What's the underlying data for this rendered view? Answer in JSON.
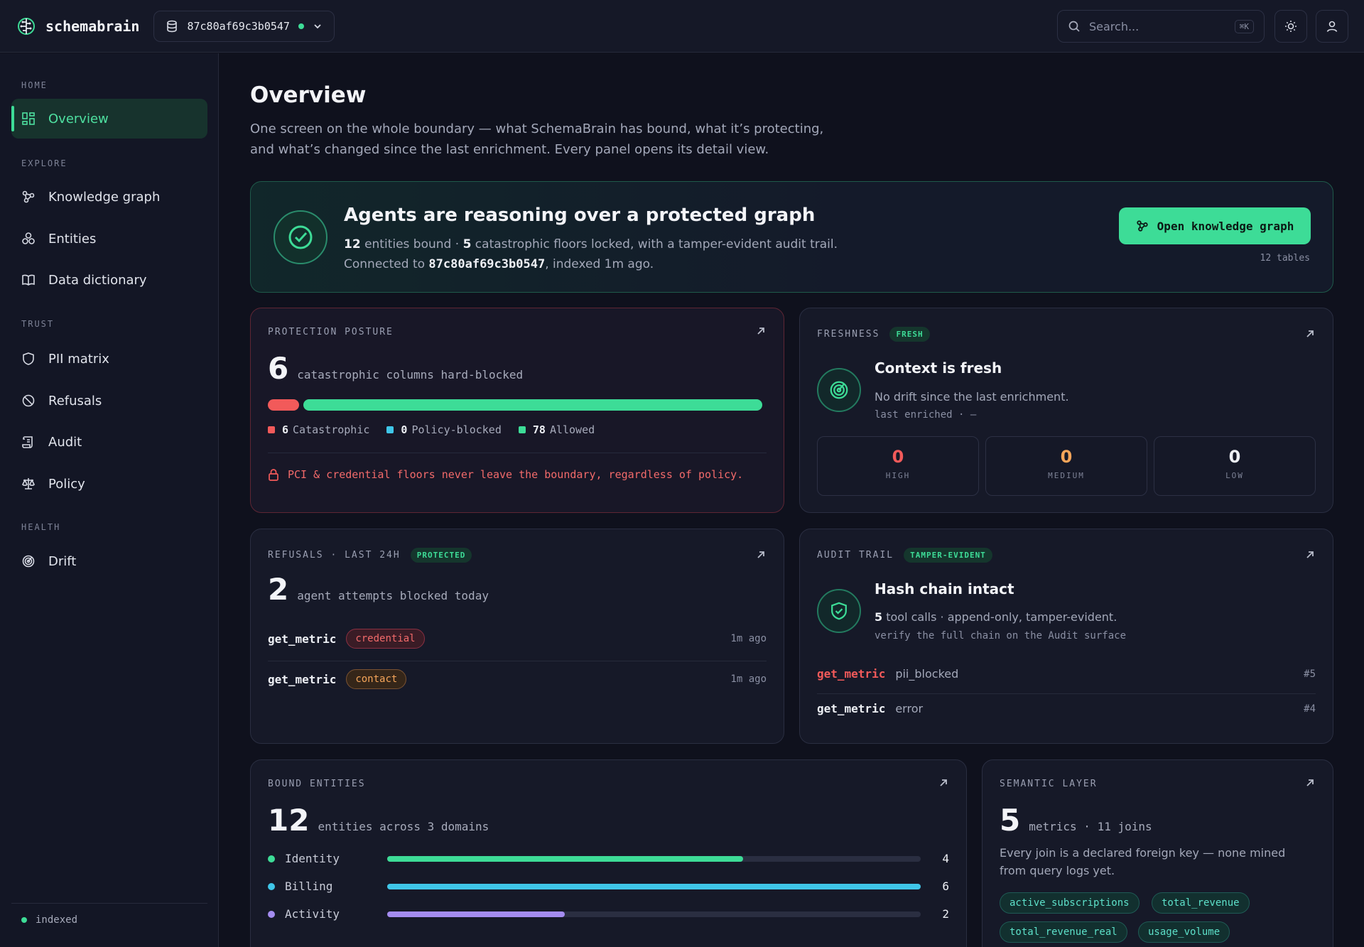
{
  "app": {
    "name": "schemabrain"
  },
  "connection": {
    "id": "87c80af69c3b0547"
  },
  "search": {
    "placeholder": "Search...",
    "shortcut": "⌘K"
  },
  "sidebar": {
    "sections": [
      "HOME",
      "EXPLORE",
      "TRUST",
      "HEALTH"
    ],
    "items": [
      {
        "label": "Overview"
      },
      {
        "label": "Knowledge graph"
      },
      {
        "label": "Entities"
      },
      {
        "label": "Data dictionary"
      },
      {
        "label": "PII matrix"
      },
      {
        "label": "Refusals"
      },
      {
        "label": "Audit"
      },
      {
        "label": "Policy"
      },
      {
        "label": "Drift"
      }
    ],
    "status": "indexed"
  },
  "page": {
    "title": "Overview",
    "subtitle": "One screen on the whole boundary — what SchemaBrain has bound, what it’s protecting, and what’s changed since the last enrichment. Every panel opens its detail view."
  },
  "hero": {
    "title": "Agents are reasoning over a protected graph",
    "entities": "12",
    "text1": " entities bound · ",
    "floors": "5",
    "text2": " catastrophic floors locked, with a tamper-evident audit trail. Connected to ",
    "conn": "87c80af69c3b0547",
    "text3": ", indexed 1m ago.",
    "button": "Open knowledge graph",
    "meta": "12 tables"
  },
  "protection": {
    "label": "PROTECTION POSTURE",
    "count": "6",
    "count_text": "catastrophic columns hard-blocked",
    "legend": [
      {
        "value": "6",
        "label": "Catastrophic",
        "color": "#f25a5a"
      },
      {
        "value": "0",
        "label": "Policy-blocked",
        "color": "#3fc6e8"
      },
      {
        "value": "78",
        "label": "Allowed",
        "color": "#3ddc97"
      }
    ],
    "note": "PCI & credential floors never leave the boundary, regardless of policy."
  },
  "freshness": {
    "label": "FRESHNESS",
    "badge": "FRESH",
    "title": "Context is fresh",
    "text": "No drift since the last enrichment.",
    "meta": "last enriched · —",
    "stats": [
      {
        "value": "0",
        "label": "HIGH",
        "color": "#f25a5a"
      },
      {
        "value": "0",
        "label": "MEDIUM",
        "color": "#f5a55a"
      },
      {
        "value": "0",
        "label": "LOW",
        "color": "#eef0f5"
      }
    ]
  },
  "refusals": {
    "label": "REFUSALS · LAST 24H",
    "badge": "PROTECTED",
    "count": "2",
    "count_text": "agent attempts blocked today",
    "rows": [
      {
        "fn": "get_metric",
        "tag": "credential",
        "ago": "1m ago"
      },
      {
        "fn": "get_metric",
        "tag": "contact",
        "ago": "1m ago"
      }
    ]
  },
  "audit": {
    "label": "AUDIT TRAIL",
    "badge": "TAMPER-EVIDENT",
    "title": "Hash chain intact",
    "calls": "5",
    "text": " tool calls · append-only, tamper-evident.",
    "meta": "verify the full chain on the Audit surface",
    "rows": [
      {
        "fn": "get_metric",
        "event": "pii_blocked",
        "id": "#5"
      },
      {
        "fn": "get_metric",
        "event": "error",
        "id": "#4"
      }
    ]
  },
  "entities": {
    "label": "BOUND ENTITIES",
    "count": "12",
    "count_text": "entities across 3 domains",
    "max": 6,
    "rows": [
      {
        "name": "Identity",
        "value": 4,
        "color": "#3ddc97"
      },
      {
        "name": "Billing",
        "value": 6,
        "color": "#3fc6e8"
      },
      {
        "name": "Activity",
        "value": 2,
        "color": "#a48cf0"
      }
    ]
  },
  "semantic": {
    "label": "SEMANTIC LAYER",
    "count": "5",
    "count_text": "metrics · 11 joins",
    "text": "Every join is a declared foreign key — none mined from query logs yet.",
    "chips": [
      "active_subscriptions",
      "total_revenue",
      "total_revenue_real",
      "usage_volume"
    ]
  }
}
